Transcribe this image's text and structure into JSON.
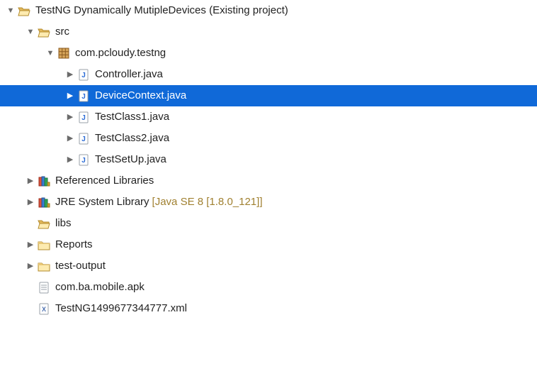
{
  "root": {
    "label": "TestNG Dynamically MutipleDevices (Existing project)"
  },
  "src": {
    "label": "src"
  },
  "pkg": {
    "label": "com.pcloudy.testng"
  },
  "files": {
    "controller": {
      "label": "Controller.java"
    },
    "devicecontext": {
      "label": "DeviceContext.java"
    },
    "testclass1": {
      "label": "TestClass1.java"
    },
    "testclass2": {
      "label": "TestClass2.java"
    },
    "testsetup": {
      "label": "TestSetUp.java"
    }
  },
  "reflib": {
    "label": "Referenced Libraries"
  },
  "jre": {
    "label": "JRE System Library",
    "suffix": "[Java SE 8 [1.8.0_121]]"
  },
  "libs": {
    "label": "libs"
  },
  "reports": {
    "label": "Reports"
  },
  "testoutput": {
    "label": "test-output"
  },
  "apk": {
    "label": "com.ba.mobile.apk"
  },
  "xml": {
    "label": "TestNG1499677344777.xml"
  }
}
